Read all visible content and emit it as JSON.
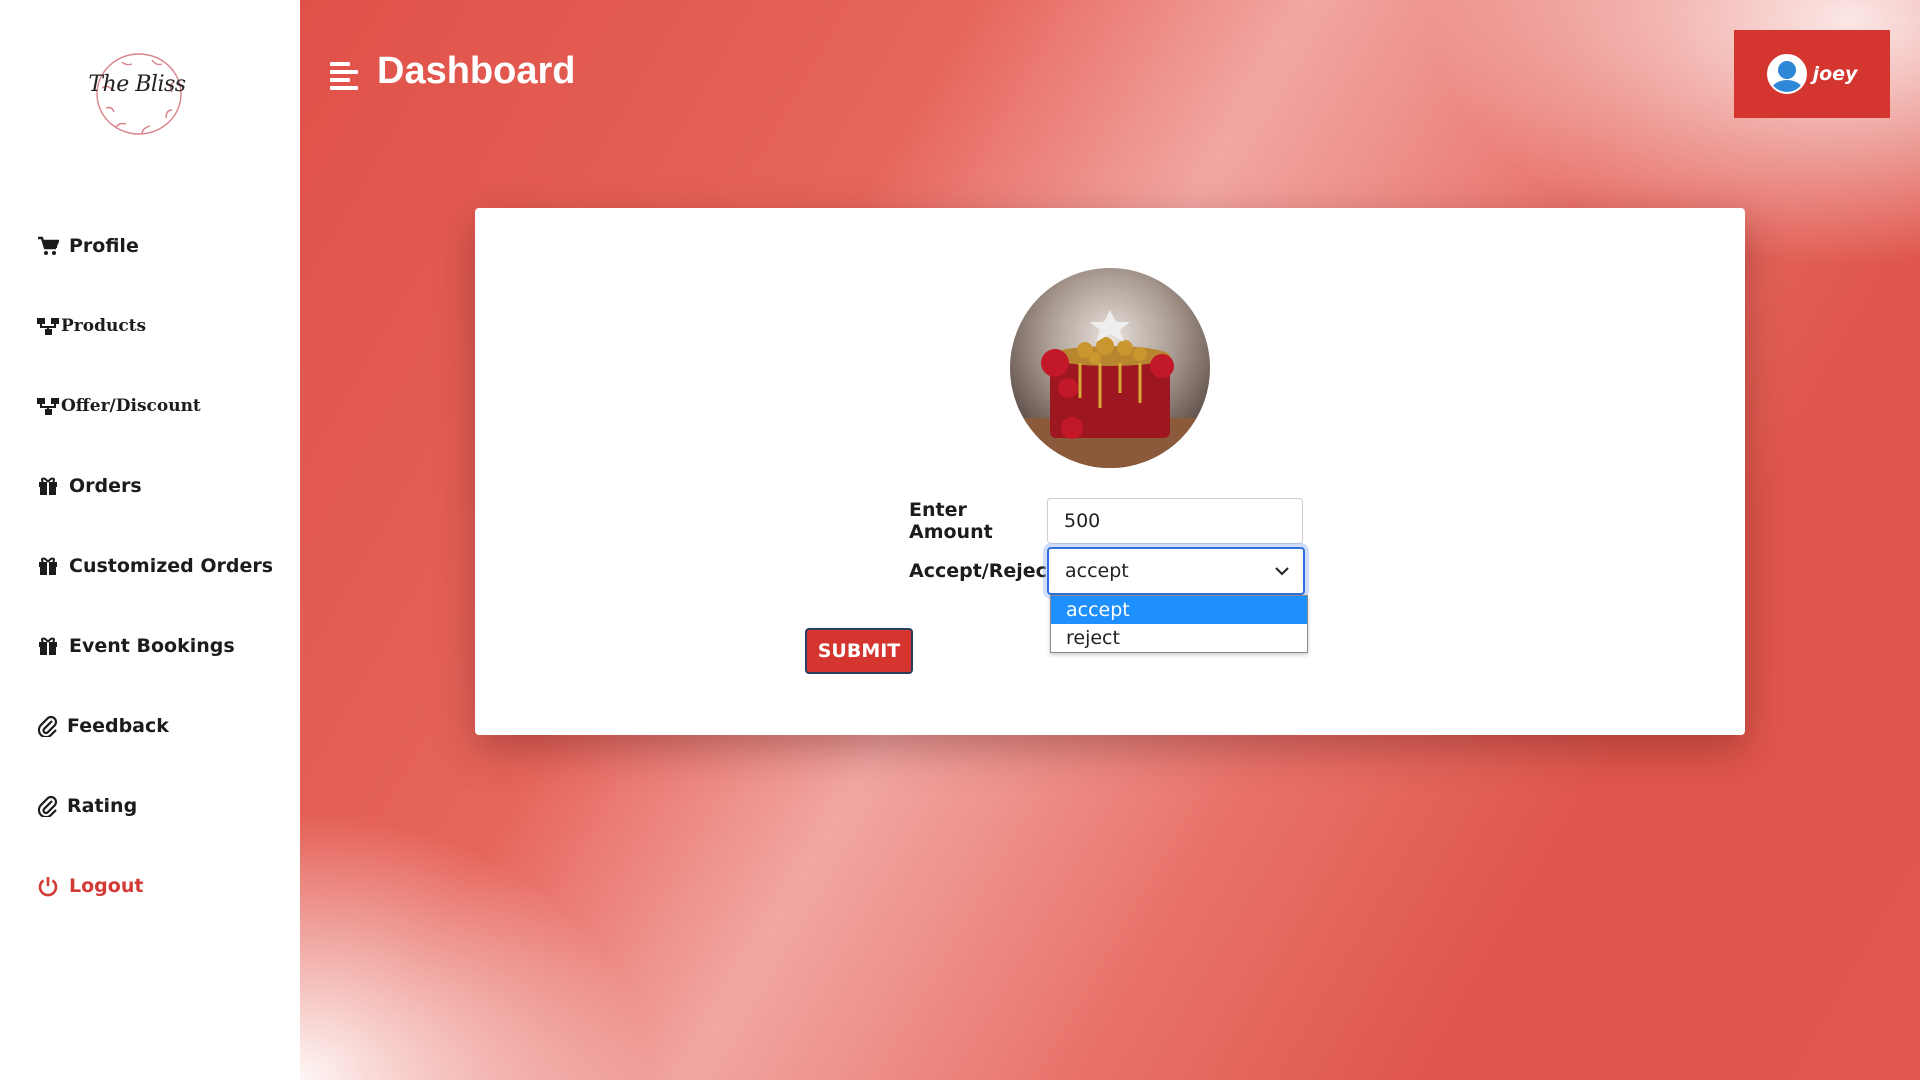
{
  "brand": {
    "logo_text": "The Bliss"
  },
  "sidebar": {
    "items": [
      {
        "label": "Profile",
        "icon": "cart-icon"
      },
      {
        "label": "Products",
        "icon": "sitemap-icon"
      },
      {
        "label": "Offer/Discount",
        "icon": "sitemap-icon"
      },
      {
        "label": "Orders",
        "icon": "gift-icon"
      },
      {
        "label": "Customized Orders",
        "icon": "gift-icon"
      },
      {
        "label": "Event Bookings",
        "icon": "gift-icon"
      },
      {
        "label": "Feedback",
        "icon": "paperclip-icon"
      },
      {
        "label": "Rating",
        "icon": "paperclip-icon"
      },
      {
        "label": "Logout",
        "icon": "power-icon"
      }
    ]
  },
  "header": {
    "title": "Dashboard",
    "user_name": "joey"
  },
  "form": {
    "amount_label": "Enter Amount",
    "amount_value": "500",
    "decision_label": "Accept/Reject!",
    "decision_value": "accept",
    "options": [
      "accept",
      "reject"
    ],
    "submit_label": "SUBMIT"
  },
  "colors": {
    "accent": "#d5352f",
    "selected_option": "#1e8fff",
    "logout": "#d33a35"
  }
}
